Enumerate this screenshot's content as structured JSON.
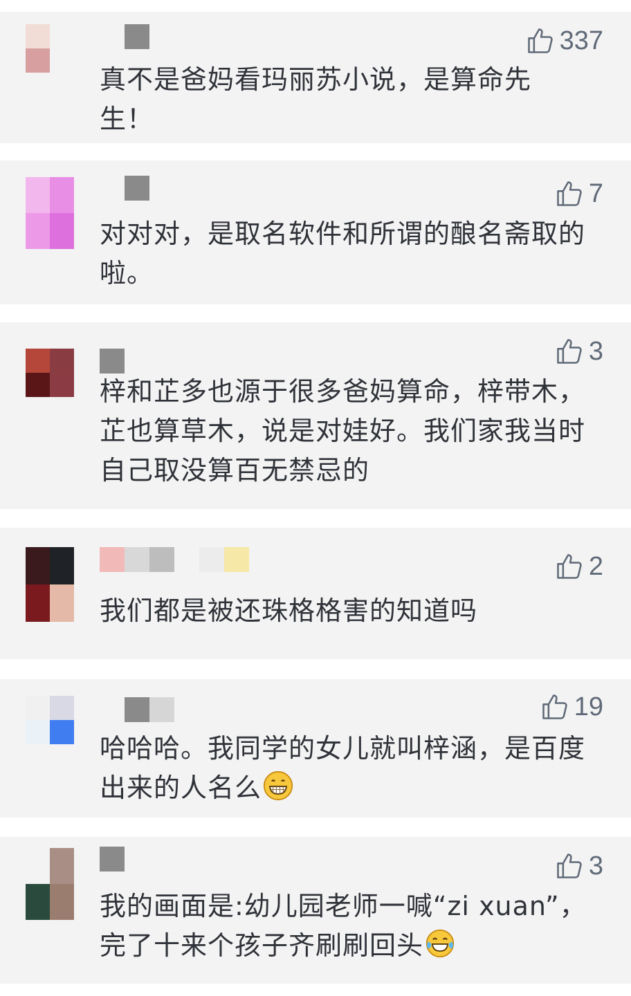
{
  "comments": [
    {
      "likes": "337",
      "text": "真不是爸妈看玛丽苏小说，是算命先生！"
    },
    {
      "likes": "7",
      "text": "对对对，是取名软件和所谓的酿名斋取的啦。"
    },
    {
      "likes": "3",
      "text": "梓和芷多也源于很多爸妈算命，梓带木，芷也算草木，说是对娃好。我们家我当时自己取没算百无禁忌的"
    },
    {
      "likes": "2",
      "text": "我们都是被还珠格格害的知道吗"
    },
    {
      "likes": "19",
      "text": "哈哈哈。我同学的女儿就叫梓涵，是百度出来的人名么",
      "emoji": "grinning-emoji"
    },
    {
      "likes": "3",
      "text": "我的画面是:幼儿园老师一喊“zi xuan”，完了十来个孩子齐刷刷回头",
      "emoji": "tears-of-joy-emoji"
    }
  ],
  "colors": {
    "card_bg": "#f3f3f3",
    "text": "#2f3238",
    "like": "#606a78"
  }
}
